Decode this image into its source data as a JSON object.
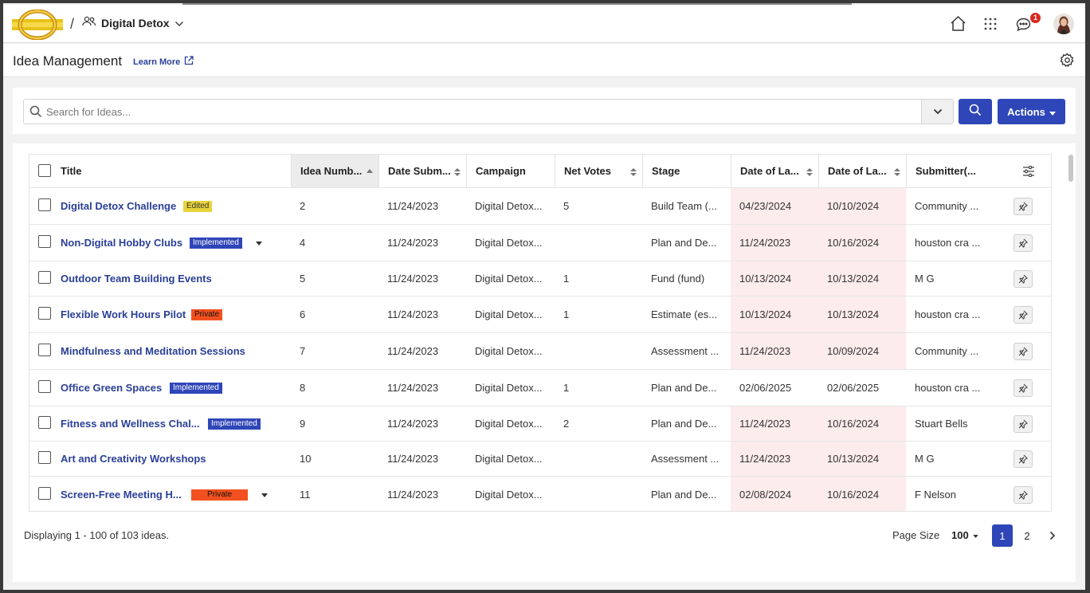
{
  "header": {
    "separator": "/",
    "workspace": "Digital Detox",
    "notifications_count": "1"
  },
  "subheader": {
    "title": "Idea Management",
    "learn_more": "Learn More"
  },
  "search": {
    "placeholder": "Search for Ideas...",
    "actions_label": "Actions"
  },
  "table": {
    "columns": [
      "Title",
      "Idea Numb...",
      "Date Subm...",
      "Campaign",
      "Net Votes",
      "Stage",
      "Date of La...",
      "Date of La...",
      "Submitter(..."
    ],
    "rows": [
      {
        "title": "Digital Detox Challenge",
        "tag": "Edited",
        "tag_type": "edited",
        "tag_caret": false,
        "number": "2",
        "date_submitted": "11/24/2023",
        "campaign": "Digital Detox...",
        "net_votes": "5",
        "stage": "Build Team (...",
        "date_last_1": "04/23/2024",
        "date_last_2": "10/10/2024",
        "submitter": "Community  ...",
        "highlight": true
      },
      {
        "title": "Non-Digital Hobby Clubs",
        "tag": "Implemented",
        "tag_type": "impl",
        "tag_caret": true,
        "number": "4",
        "date_submitted": "11/24/2023",
        "campaign": "Digital Detox...",
        "net_votes": "",
        "stage": "Plan and De...",
        "date_last_1": "11/24/2023",
        "date_last_2": "10/16/2024",
        "submitter": "houston cra ...",
        "highlight": true
      },
      {
        "title": "Outdoor Team Building Events",
        "tag": "",
        "tag_type": "",
        "tag_caret": false,
        "number": "5",
        "date_submitted": "11/24/2023",
        "campaign": "Digital Detox...",
        "net_votes": "1",
        "stage": "Fund (fund)",
        "date_last_1": "10/13/2024",
        "date_last_2": "10/13/2024",
        "submitter": "M G",
        "highlight": true
      },
      {
        "title": "Flexible Work Hours Pilot",
        "tag": "Private",
        "tag_type": "priv",
        "tag_caret": false,
        "number": "6",
        "date_submitted": "11/24/2023",
        "campaign": "Digital Detox...",
        "net_votes": "1",
        "stage": "Estimate (es...",
        "date_last_1": "10/13/2024",
        "date_last_2": "10/13/2024",
        "submitter": "houston cra ...",
        "highlight": true
      },
      {
        "title": "Mindfulness and Meditation Sessions",
        "tag": "",
        "tag_type": "",
        "tag_caret": false,
        "number": "7",
        "date_submitted": "11/24/2023",
        "campaign": "Digital Detox...",
        "net_votes": "",
        "stage": "Assessment ...",
        "date_last_1": "11/24/2023",
        "date_last_2": "10/09/2024",
        "submitter": "Community  ...",
        "highlight": true
      },
      {
        "title": "Office Green Spaces",
        "tag": "Implemented",
        "tag_type": "impl",
        "tag_caret": false,
        "number": "8",
        "date_submitted": "11/24/2023",
        "campaign": "Digital Detox...",
        "net_votes": "1",
        "stage": "Plan and De...",
        "date_last_1": "02/06/2025",
        "date_last_2": "02/06/2025",
        "submitter": "houston cra ...",
        "highlight": false
      },
      {
        "title": "Fitness and Wellness Chal...",
        "tag": "Implemented",
        "tag_type": "impl",
        "tag_caret": false,
        "number": "9",
        "date_submitted": "11/24/2023",
        "campaign": "Digital Detox...",
        "net_votes": "2",
        "stage": "Plan and De...",
        "date_last_1": "11/24/2023",
        "date_last_2": "10/16/2024",
        "submitter": "Stuart Bells",
        "highlight": true
      },
      {
        "title": "Art and Creativity Workshops",
        "tag": "",
        "tag_type": "",
        "tag_caret": false,
        "number": "10",
        "date_submitted": "11/24/2023",
        "campaign": "Digital Detox...",
        "net_votes": "",
        "stage": "Assessment ...",
        "date_last_1": "11/24/2023",
        "date_last_2": "10/13/2024",
        "submitter": "M G",
        "highlight": true
      },
      {
        "title": "Screen-Free Meeting H...",
        "tag": "Private",
        "tag_type": "priv",
        "tag_caret": true,
        "number": "11",
        "date_submitted": "11/24/2023",
        "campaign": "Digital Detox...",
        "net_votes": "",
        "stage": "Plan and De...",
        "date_last_1": "02/08/2024",
        "date_last_2": "10/16/2024",
        "submitter": "F Nelson",
        "highlight": true
      }
    ]
  },
  "footer": {
    "display_text": "Displaying 1 - 100 of 103 ideas.",
    "page_size_label": "Page Size",
    "page_size_value": "100",
    "pages": [
      "1",
      "2"
    ],
    "current_page": "1"
  },
  "icons": [
    "logo",
    "users-icon",
    "chevron-down-icon",
    "home-icon",
    "apps-grid-icon",
    "chat-icon",
    "avatar",
    "external-link-icon",
    "gear-icon",
    "search-icon",
    "column-settings-icon",
    "pin-icon",
    "sort-icon",
    "chevron-right-icon"
  ],
  "colors": {
    "accent": "#2e46b8",
    "link": "#2a3f97",
    "highlight": "#fdecec",
    "edited": "#e8d33a",
    "private": "#f2511f"
  }
}
